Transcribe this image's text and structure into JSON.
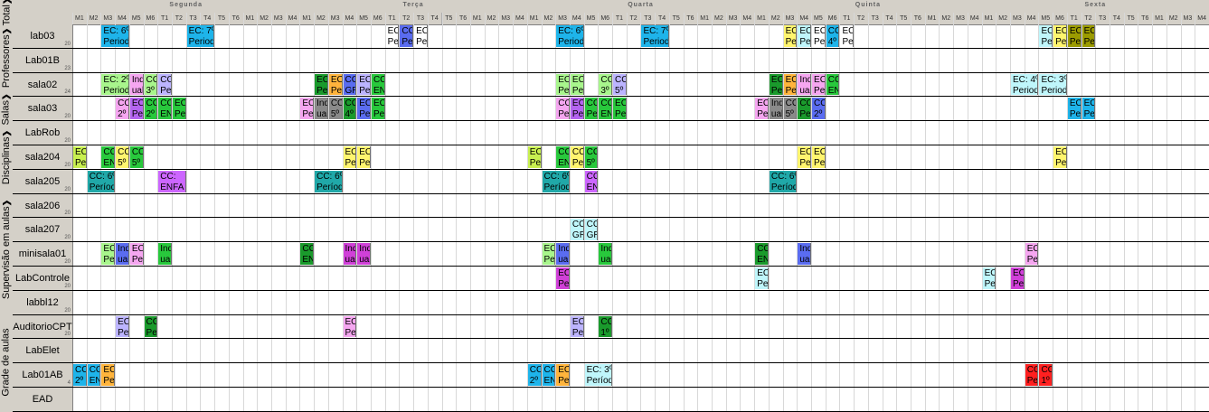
{
  "tabs": [
    {
      "label": "Grade de aulas",
      "chevron": ""
    },
    {
      "label": "Supervisão em aulas",
      "chevron": "❯"
    },
    {
      "label": "Disciplinas",
      "chevron": "❯"
    },
    {
      "label": "Salas",
      "chevron": "❯"
    },
    {
      "label": "Professores",
      "chevron": "❯"
    },
    {
      "label": "Total",
      "chevron": "❯"
    }
  ],
  "days": [
    "Segunda",
    "Terça",
    "Quarta",
    "Quinta",
    "Sexta"
  ],
  "slots": [
    "M1",
    "M2",
    "M3",
    "M4",
    "M5",
    "M6",
    "T1",
    "T2",
    "T3",
    "T4",
    "T5",
    "T6",
    "M1",
    "M2",
    "M3",
    "M4"
  ],
  "rooms": [
    {
      "name": "lab03",
      "cap": "20"
    },
    {
      "name": "Lab01B",
      "cap": "23"
    },
    {
      "name": "sala02",
      "cap": "24"
    },
    {
      "name": "sala03",
      "cap": "20"
    },
    {
      "name": "LabRob",
      "cap": "20"
    },
    {
      "name": "sala204",
      "cap": "20"
    },
    {
      "name": "sala205",
      "cap": "20"
    },
    {
      "name": "sala206",
      "cap": "20"
    },
    {
      "name": "sala207",
      "cap": "20"
    },
    {
      "name": "minisala01",
      "cap": "20"
    },
    {
      "name": "LabControle",
      "cap": "20"
    },
    {
      "name": "labbl12",
      "cap": "20"
    },
    {
      "name": "AuditorioCPT",
      "cap": "20"
    },
    {
      "name": "LabElet",
      "cap": ""
    },
    {
      "name": "Lab01AB",
      "cap": "4"
    },
    {
      "name": "EAD",
      "cap": ""
    }
  ],
  "palette": {
    "cyan": "#1eb4ea",
    "white": "#ffffff",
    "blue": "#5a6cf0",
    "yellow": "#fff56e",
    "lyellow": "#ffff9c",
    "lightcyan": "#bff6fb",
    "olive": "#9b9b00",
    "pink": "#f5a6f0",
    "lightgreen": "#a8f58c",
    "orange": "#ffb43c",
    "lavender": "#bcb4ff",
    "green": "#28c83c",
    "dkgreen": "#1a9a2c",
    "gray": "#8a8a8a",
    "purple": "#b464f0",
    "magenta": "#d040d8",
    "violet": "#cc66ff",
    "teal": "#20a8a8",
    "red": "#ff2020",
    "lime": "#c8f050",
    "dgray": "#707070"
  },
  "blocks": [
    {
      "row": 0,
      "day": 0,
      "s": 2,
      "n": 2,
      "l1": "EC: 6º",
      "l2": "Period",
      "c": "cyan"
    },
    {
      "row": 0,
      "day": 0,
      "s": 8,
      "n": 2,
      "l1": "EC: 7º",
      "l2": "Period",
      "c": "cyan"
    },
    {
      "row": 0,
      "day": 1,
      "s": 6,
      "n": 1,
      "l1": "EC: 7º",
      "l2": "Period",
      "c": "white"
    },
    {
      "row": 0,
      "day": 1,
      "s": 7,
      "n": 1,
      "l1": "CC: 4º",
      "l2": "Period",
      "c": "blue"
    },
    {
      "row": 0,
      "day": 1,
      "s": 8,
      "n": 1,
      "l1": "EC: 7º",
      "l2": "Period",
      "c": "white"
    },
    {
      "row": 0,
      "day": 2,
      "s": 2,
      "n": 2,
      "l1": "EC: 6º",
      "l2": "Period",
      "c": "cyan"
    },
    {
      "row": 0,
      "day": 2,
      "s": 8,
      "n": 2,
      "l1": "EC: 7º",
      "l2": "Period",
      "c": "cyan"
    },
    {
      "row": 0,
      "day": 3,
      "s": 2,
      "n": 1,
      "l1": "EC: 6º",
      "l2": "Period",
      "c": "yellow"
    },
    {
      "row": 0,
      "day": 3,
      "s": 3,
      "n": 1,
      "l1": "EC: 6º",
      "l2": "Period",
      "c": "lightcyan"
    },
    {
      "row": 0,
      "day": 3,
      "s": 4,
      "n": 1,
      "l1": "EC: 7º",
      "l2": "Period",
      "c": "white"
    },
    {
      "row": 0,
      "day": 3,
      "s": 5,
      "n": 1,
      "l1": "CC:",
      "l2": "4º",
      "c": "cyan"
    },
    {
      "row": 0,
      "day": 3,
      "s": 6,
      "n": 1,
      "l1": "EC: 7º",
      "l2": "Period",
      "c": "white"
    },
    {
      "row": 0,
      "day": 4,
      "s": 4,
      "n": 1,
      "l1": "EC: 6º",
      "l2": "Period",
      "c": "lightcyan"
    },
    {
      "row": 0,
      "day": 4,
      "s": 5,
      "n": 1,
      "l1": "EC: 6º",
      "l2": "Period",
      "c": "yellow"
    },
    {
      "row": 0,
      "day": 4,
      "s": 6,
      "n": 1,
      "l1": "EC: 1º",
      "l2": "Period",
      "c": "olive"
    },
    {
      "row": 0,
      "day": 4,
      "s": 7,
      "n": 1,
      "l1": "EC: 1º",
      "l2": "Period",
      "c": "olive"
    },
    {
      "row": 2,
      "day": 0,
      "s": 2,
      "n": 2,
      "l1": "EC: 2º",
      "l2": "Period",
      "c": "lightgreen"
    },
    {
      "row": 2,
      "day": 0,
      "s": 4,
      "n": 1,
      "l1": "Individ",
      "l2": "ual /",
      "c": "pink"
    },
    {
      "row": 2,
      "day": 0,
      "s": 5,
      "n": 1,
      "l1": "CC:",
      "l2": "3º",
      "c": "lightgreen"
    },
    {
      "row": 2,
      "day": 0,
      "s": 6,
      "n": 1,
      "l1": "CC: 5º",
      "l2": "Period",
      "c": "lavender"
    },
    {
      "row": 2,
      "day": 1,
      "s": 1,
      "n": 1,
      "l1": "EC: 2º",
      "l2": "Period",
      "c": "dkgreen"
    },
    {
      "row": 2,
      "day": 1,
      "s": 2,
      "n": 1,
      "l1": "EC: 4º",
      "l2": "Period",
      "c": "orange"
    },
    {
      "row": 2,
      "day": 1,
      "s": 3,
      "n": 1,
      "l1": "CC 4o",
      "l2": "GRAD",
      "c": "blue"
    },
    {
      "row": 2,
      "day": 1,
      "s": 4,
      "n": 1,
      "l1": "EC: 3º",
      "l2": "Period",
      "c": "lavender"
    },
    {
      "row": 2,
      "day": 1,
      "s": 5,
      "n": 1,
      "l1": "CC",
      "l2": "ENFA",
      "c": "green"
    },
    {
      "row": 2,
      "day": 2,
      "s": 2,
      "n": 1,
      "l1": "EC: 2º",
      "l2": "Period",
      "c": "lightgreen"
    },
    {
      "row": 2,
      "day": 2,
      "s": 3,
      "n": 1,
      "l1": "EC: 4º",
      "l2": "Period",
      "c": "lightgreen"
    },
    {
      "row": 2,
      "day": 2,
      "s": 5,
      "n": 1,
      "l1": "CC:",
      "l2": "3º",
      "c": "lightgreen"
    },
    {
      "row": 2,
      "day": 2,
      "s": 6,
      "n": 1,
      "l1": "CC:",
      "l2": "5º",
      "c": "lavender"
    },
    {
      "row": 2,
      "day": 3,
      "s": 1,
      "n": 1,
      "l1": "EC: 2º",
      "l2": "Period",
      "c": "dkgreen"
    },
    {
      "row": 2,
      "day": 3,
      "s": 2,
      "n": 1,
      "l1": "EC: 4º",
      "l2": "Period",
      "c": "orange"
    },
    {
      "row": 2,
      "day": 3,
      "s": 3,
      "n": 1,
      "l1": "Individ",
      "l2": "ual /",
      "c": "pink"
    },
    {
      "row": 2,
      "day": 3,
      "s": 4,
      "n": 1,
      "l1": "EC: 3º",
      "l2": "Period",
      "c": "pink"
    },
    {
      "row": 2,
      "day": 3,
      "s": 5,
      "n": 1,
      "l1": "CC",
      "l2": "ENFA",
      "c": "green"
    },
    {
      "row": 2,
      "day": 4,
      "s": 2,
      "n": 2,
      "l1": "EC: 4º",
      "l2": "Period",
      "c": "lightcyan"
    },
    {
      "row": 2,
      "day": 4,
      "s": 4,
      "n": 2,
      "l1": "EC: 3º",
      "l2": "Period",
      "c": "lightcyan"
    },
    {
      "row": 3,
      "day": 0,
      "s": 3,
      "n": 1,
      "l1": "CC:",
      "l2": "2º",
      "c": "pink"
    },
    {
      "row": 3,
      "day": 0,
      "s": 4,
      "n": 1,
      "l1": "EC: 6º",
      "l2": "Period",
      "c": "purple"
    },
    {
      "row": 3,
      "day": 0,
      "s": 5,
      "n": 1,
      "l1": "CC:",
      "l2": "2º",
      "c": "green"
    },
    {
      "row": 3,
      "day": 0,
      "s": 6,
      "n": 1,
      "l1": "CC",
      "l2": "ENFA",
      "c": "green"
    },
    {
      "row": 3,
      "day": 0,
      "s": 7,
      "n": 1,
      "l1": "EC: 1º",
      "l2": "Period",
      "c": "green"
    },
    {
      "row": 3,
      "day": 1,
      "s": 0,
      "n": 1,
      "l1": "EC: 6º",
      "l2": "Period",
      "c": "pink"
    },
    {
      "row": 3,
      "day": 1,
      "s": 1,
      "n": 1,
      "l1": "Individ",
      "l2": "ual /",
      "c": "gray"
    },
    {
      "row": 3,
      "day": 1,
      "s": 2,
      "n": 1,
      "l1": "CC:",
      "l2": "5º",
      "c": "gray"
    },
    {
      "row": 3,
      "day": 1,
      "s": 3,
      "n": 1,
      "l1": "CC:",
      "l2": "4º",
      "c": "dkgreen"
    },
    {
      "row": 3,
      "day": 1,
      "s": 4,
      "n": 1,
      "l1": "EC: 2º",
      "l2": "Period",
      "c": "blue"
    },
    {
      "row": 3,
      "day": 1,
      "s": 5,
      "n": 1,
      "l1": "EC: 1º",
      "l2": "Period",
      "c": "green"
    },
    {
      "row": 3,
      "day": 2,
      "s": 2,
      "n": 1,
      "l1": "CC: 2º",
      "l2": "Period",
      "c": "pink"
    },
    {
      "row": 3,
      "day": 2,
      "s": 3,
      "n": 1,
      "l1": "EC: 6º",
      "l2": "Period",
      "c": "purple"
    },
    {
      "row": 3,
      "day": 2,
      "s": 4,
      "n": 1,
      "l1": "CC: 2º",
      "l2": "Period",
      "c": "green"
    },
    {
      "row": 3,
      "day": 2,
      "s": 5,
      "n": 1,
      "l1": "CC",
      "l2": "ENFA",
      "c": "green"
    },
    {
      "row": 3,
      "day": 2,
      "s": 6,
      "n": 1,
      "l1": "EC: 5º",
      "l2": "Period",
      "c": "green"
    },
    {
      "row": 3,
      "day": 3,
      "s": 0,
      "n": 1,
      "l1": "EC: 6º",
      "l2": "Period",
      "c": "pink"
    },
    {
      "row": 3,
      "day": 3,
      "s": 1,
      "n": 1,
      "l1": "Individ",
      "l2": "ual /",
      "c": "gray"
    },
    {
      "row": 3,
      "day": 3,
      "s": 2,
      "n": 1,
      "l1": "CC:",
      "l2": "5º",
      "c": "gray"
    },
    {
      "row": 3,
      "day": 3,
      "s": 3,
      "n": 1,
      "l1": "CC: 4º",
      "l2": "Period",
      "c": "dkgreen"
    },
    {
      "row": 3,
      "day": 3,
      "s": 4,
      "n": 1,
      "l1": "CC:",
      "l2": "2º",
      "c": "blue"
    },
    {
      "row": 3,
      "day": 4,
      "s": 6,
      "n": 1,
      "l1": "EC: 5º",
      "l2": "Period",
      "c": "cyan"
    },
    {
      "row": 3,
      "day": 4,
      "s": 7,
      "n": 1,
      "l1": "EC: 5º",
      "l2": "Period",
      "c": "cyan"
    },
    {
      "row": 5,
      "day": 0,
      "s": 0,
      "n": 1,
      "l1": "EC: 2º",
      "l2": "Period",
      "c": "lime"
    },
    {
      "row": 5,
      "day": 0,
      "s": 2,
      "n": 1,
      "l1": "CC",
      "l2": "ENFA",
      "c": "green"
    },
    {
      "row": 5,
      "day": 0,
      "s": 3,
      "n": 1,
      "l1": "CC:",
      "l2": "5º",
      "c": "yellow"
    },
    {
      "row": 5,
      "day": 0,
      "s": 4,
      "n": 1,
      "l1": "CC:",
      "l2": "5º",
      "c": "green"
    },
    {
      "row": 5,
      "day": 1,
      "s": 3,
      "n": 1,
      "l1": "EC: 2º",
      "l2": "Period",
      "c": "yellow"
    },
    {
      "row": 5,
      "day": 1,
      "s": 4,
      "n": 1,
      "l1": "EC: 5º",
      "l2": "Period",
      "c": "yellow"
    },
    {
      "row": 5,
      "day": 2,
      "s": 0,
      "n": 1,
      "l1": "EC: 2º",
      "l2": "Period",
      "c": "lime"
    },
    {
      "row": 5,
      "day": 2,
      "s": 2,
      "n": 1,
      "l1": "CC",
      "l2": "ENFA",
      "c": "green"
    },
    {
      "row": 5,
      "day": 2,
      "s": 3,
      "n": 1,
      "l1": "CC: 5º",
      "l2": "Period",
      "c": "yellow"
    },
    {
      "row": 5,
      "day": 2,
      "s": 4,
      "n": 1,
      "l1": "CC:",
      "l2": "5º",
      "c": "green"
    },
    {
      "row": 5,
      "day": 3,
      "s": 3,
      "n": 1,
      "l1": "EC: 2º",
      "l2": "Period",
      "c": "yellow"
    },
    {
      "row": 5,
      "day": 3,
      "s": 4,
      "n": 1,
      "l1": "EC: 5º",
      "l2": "Period",
      "c": "yellow"
    },
    {
      "row": 5,
      "day": 4,
      "s": 5,
      "n": 1,
      "l1": "EC: 5º",
      "l2": "Period",
      "c": "yellow"
    },
    {
      "row": 6,
      "day": 0,
      "s": 1,
      "n": 2,
      "l1": "CC: 6º",
      "l2": "Período",
      "c": "teal"
    },
    {
      "row": 6,
      "day": 0,
      "s": 6,
      "n": 2,
      "l1": "CC:",
      "l2": "ENFA",
      "c": "violet"
    },
    {
      "row": 6,
      "day": 1,
      "s": 1,
      "n": 2,
      "l1": "CC: 6º",
      "l2": "Período",
      "c": "teal"
    },
    {
      "row": 6,
      "day": 2,
      "s": 1,
      "n": 2,
      "l1": "CC: 6º",
      "l2": "Período",
      "c": "teal"
    },
    {
      "row": 6,
      "day": 2,
      "s": 4,
      "n": 1,
      "l1": "CC:",
      "l2": "ENFA",
      "c": "violet"
    },
    {
      "row": 6,
      "day": 3,
      "s": 1,
      "n": 2,
      "l1": "CC: 6º",
      "l2": "Período",
      "c": "teal"
    },
    {
      "row": 8,
      "day": 2,
      "s": 3,
      "n": 1,
      "l1": "CC 4o",
      "l2": "GRAD",
      "c": "lightcyan"
    },
    {
      "row": 8,
      "day": 2,
      "s": 4,
      "n": 1,
      "l1": "CC 4o",
      "l2": "GRAD",
      "c": "lightcyan"
    },
    {
      "row": 9,
      "day": 0,
      "s": 2,
      "n": 1,
      "l1": "EC: 8º",
      "l2": "Period",
      "c": "lightgreen"
    },
    {
      "row": 9,
      "day": 0,
      "s": 3,
      "n": 1,
      "l1": "Individ",
      "l2": "ual /",
      "c": "blue"
    },
    {
      "row": 9,
      "day": 0,
      "s": 4,
      "n": 1,
      "l1": "EC: 8º",
      "l2": "Period",
      "c": "pink"
    },
    {
      "row": 9,
      "day": 0,
      "s": 6,
      "n": 1,
      "l1": "Individ",
      "l2": "ual /",
      "c": "green"
    },
    {
      "row": 9,
      "day": 1,
      "s": 0,
      "n": 1,
      "l1": "CC",
      "l2": "ENFA",
      "c": "dkgreen"
    },
    {
      "row": 9,
      "day": 1,
      "s": 3,
      "n": 1,
      "l1": "Individ",
      "l2": "ual /",
      "c": "magenta"
    },
    {
      "row": 9,
      "day": 1,
      "s": 4,
      "n": 1,
      "l1": "Individ",
      "l2": "ual /",
      "c": "magenta"
    },
    {
      "row": 9,
      "day": 2,
      "s": 1,
      "n": 1,
      "l1": "EC: 8º",
      "l2": "Period",
      "c": "lightgreen"
    },
    {
      "row": 9,
      "day": 2,
      "s": 2,
      "n": 1,
      "l1": "Individ",
      "l2": "ual /",
      "c": "blue"
    },
    {
      "row": 9,
      "day": 2,
      "s": 5,
      "n": 1,
      "l1": "Individ",
      "l2": "ual /",
      "c": "green"
    },
    {
      "row": 9,
      "day": 3,
      "s": 0,
      "n": 1,
      "l1": "CC",
      "l2": "ENFA",
      "c": "dkgreen"
    },
    {
      "row": 9,
      "day": 3,
      "s": 3,
      "n": 1,
      "l1": "Individ",
      "l2": "ual /",
      "c": "blue"
    },
    {
      "row": 9,
      "day": 4,
      "s": 3,
      "n": 1,
      "l1": "EC: 8º",
      "l2": "Period",
      "c": "pink"
    },
    {
      "row": 10,
      "day": 2,
      "s": 2,
      "n": 1,
      "l1": "EC: 8º",
      "l2": "Period",
      "c": "magenta"
    },
    {
      "row": 10,
      "day": 3,
      "s": 0,
      "n": 1,
      "l1": "EC: 8º",
      "l2": "Period",
      "c": "lightcyan"
    },
    {
      "row": 10,
      "day": 4,
      "s": 0,
      "n": 1,
      "l1": "EC: 8º",
      "l2": "Period",
      "c": "lightcyan"
    },
    {
      "row": 10,
      "day": 4,
      "s": 2,
      "n": 1,
      "l1": "EC: 8º",
      "l2": "Period",
      "c": "magenta"
    },
    {
      "row": 12,
      "day": 0,
      "s": 3,
      "n": 1,
      "l1": "EC: 1º",
      "l2": "Period",
      "c": "lavender"
    },
    {
      "row": 12,
      "day": 0,
      "s": 5,
      "n": 1,
      "l1": "CC: 1º",
      "l2": "Period",
      "c": "dkgreen"
    },
    {
      "row": 12,
      "day": 1,
      "s": 3,
      "n": 1,
      "l1": "EC: 1º",
      "l2": "Period",
      "c": "pink"
    },
    {
      "row": 12,
      "day": 2,
      "s": 3,
      "n": 1,
      "l1": "EC: 1º",
      "l2": "Period",
      "c": "lavender"
    },
    {
      "row": 12,
      "day": 2,
      "s": 5,
      "n": 1,
      "l1": "CC:",
      "l2": "1º",
      "c": "dkgreen"
    },
    {
      "row": 14,
      "day": 0,
      "s": 0,
      "n": 1,
      "l1": "CC:",
      "l2": "2º",
      "c": "cyan"
    },
    {
      "row": 14,
      "day": 0,
      "s": 1,
      "n": 1,
      "l1": "CC",
      "l2": "ENFA",
      "c": "cyan"
    },
    {
      "row": 14,
      "day": 0,
      "s": 2,
      "n": 1,
      "l1": "EC: 2º",
      "l2": "Period",
      "c": "orange"
    },
    {
      "row": 14,
      "day": 2,
      "s": 0,
      "n": 1,
      "l1": "CC:",
      "l2": "2º",
      "c": "cyan"
    },
    {
      "row": 14,
      "day": 2,
      "s": 1,
      "n": 1,
      "l1": "CC",
      "l2": "ENFA",
      "c": "cyan"
    },
    {
      "row": 14,
      "day": 2,
      "s": 2,
      "n": 1,
      "l1": "EC: 2º",
      "l2": "Period",
      "c": "orange"
    },
    {
      "row": 14,
      "day": 2,
      "s": 4,
      "n": 2,
      "l1": "EC: 3º",
      "l2": "Período, CC",
      "c": "lightcyan"
    },
    {
      "row": 14,
      "day": 4,
      "s": 3,
      "n": 1,
      "l1": "CC: 1º",
      "l2": "Period",
      "c": "red"
    },
    {
      "row": 14,
      "day": 4,
      "s": 4,
      "n": 1,
      "l1": "CC:",
      "l2": "1º",
      "c": "red"
    }
  ]
}
